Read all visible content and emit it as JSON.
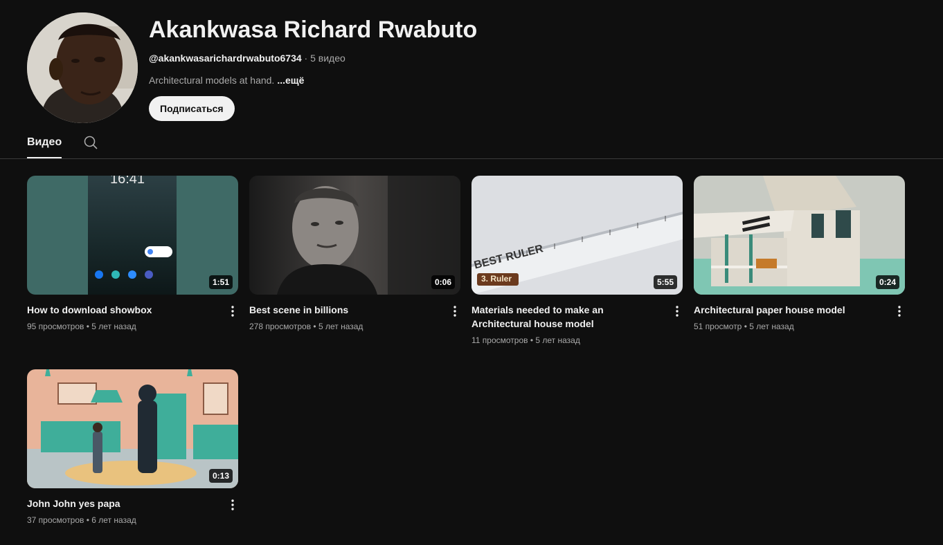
{
  "channel": {
    "name": "Akankwasa Richard Rwabuto",
    "handle": "@akankwasarichardrwabuto6734",
    "separator": " · ",
    "video_count": "5 видео",
    "description": "Architectural models at hand.",
    "more_label": "...ещё",
    "subscribe_label": "Подписаться"
  },
  "tabs": {
    "videos_label": "Видео",
    "search_icon": "search-icon"
  },
  "videos": [
    {
      "title": "How to download showbox",
      "views": "95 просмотров",
      "age": "5 лет назад",
      "duration": "1:51"
    },
    {
      "title": "Best scene in billions",
      "views": "278 просмотров",
      "age": "5 лет назад",
      "duration": "0:06"
    },
    {
      "title": "Materials needed to make an Architectural house model",
      "views": "11 просмотров",
      "age": "5 лет назад",
      "duration": "5:55"
    },
    {
      "title": "Architectural paper house model",
      "views": "51 просмотр",
      "age": "5 лет назад",
      "duration": "0:24"
    },
    {
      "title": "John John yes papa",
      "views": "37 просмотров",
      "age": "6 лет назад",
      "duration": "0:13"
    }
  ],
  "thumbnail_text": {
    "clock": "16:41",
    "ruler_label": "BEST RULER",
    "ruler_tag": "3. Ruler"
  },
  "stat_separator": " • ",
  "colors": {
    "background": "#0f0f0f",
    "text_primary": "#f1f1f1",
    "text_secondary": "#aaaaaa",
    "subscribe_bg": "#f1f1f1"
  }
}
